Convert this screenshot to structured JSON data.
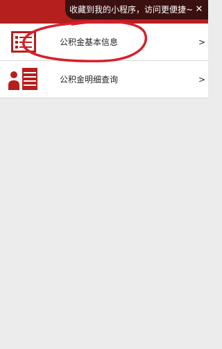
{
  "banner": {
    "tip_text": "收藏到我的小程序，访问更便捷~",
    "close_glyph": "✕"
  },
  "menu": {
    "items": [
      {
        "label": "公积金基本信息",
        "arrow": ">",
        "icon": "info-card-icon"
      },
      {
        "label": "公积金明细查询",
        "arrow": ">",
        "icon": "user-list-icon"
      }
    ]
  },
  "colors": {
    "brand_red": "#b51f1d",
    "tip_bg": "#3b1010",
    "annotation_red": "#d91f2a",
    "page_bg": "#ececec"
  }
}
